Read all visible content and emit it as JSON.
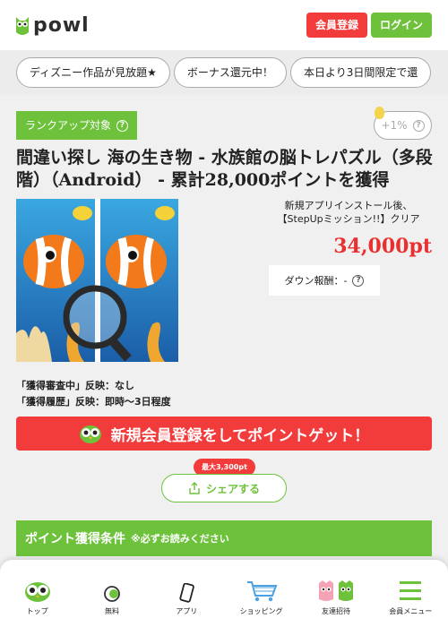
{
  "header": {
    "logo_text": "powl",
    "register_label": "会員登録",
    "login_label": "ログイン"
  },
  "tags": [
    "ディズニー作品が見放題★",
    "ボーナス還元中！",
    "本日より3日間限定で還"
  ],
  "offer": {
    "rankup_label": "ランクアップ対象",
    "plus_label": "+1%",
    "title": "間違い探し 海の生き物 - 水族館の脳トレパズル（多段階）（Android） - 累計28,000ポイントを獲得",
    "mission_line1": "新規アプリインストール後、",
    "mission_line2": "【StepUpミッション!!】クリア",
    "points": "34,000pt",
    "down_reward": "ダウン報酬：-",
    "reflect_line1": "「獲得審査中」反映：なし",
    "reflect_line2": "「獲得履歴」反映：即時～3日程度",
    "signup_label": "新規会員登録をしてポイントゲット！",
    "share_badge": "最大3,300pt",
    "share_label": "シェアする",
    "conditions_title": "ポイント獲得条件",
    "conditions_note": "※必ずお読みください"
  },
  "bottom_nav": [
    {
      "label": "トップ",
      "icon": "owl-icon"
    },
    {
      "label": "無料",
      "icon": "free-coin-icon"
    },
    {
      "label": "アプリ",
      "icon": "smartphone-icon"
    },
    {
      "label": "ショッピング",
      "icon": "cart-icon"
    },
    {
      "label": "友達招待",
      "icon": "friends-owl-icon"
    },
    {
      "label": "会員メニュー",
      "icon": "hamburger-menu-icon"
    }
  ],
  "colors": {
    "accent_green": "#6ec23b",
    "accent_red": "#f23b3b",
    "points_red": "#e83030"
  }
}
